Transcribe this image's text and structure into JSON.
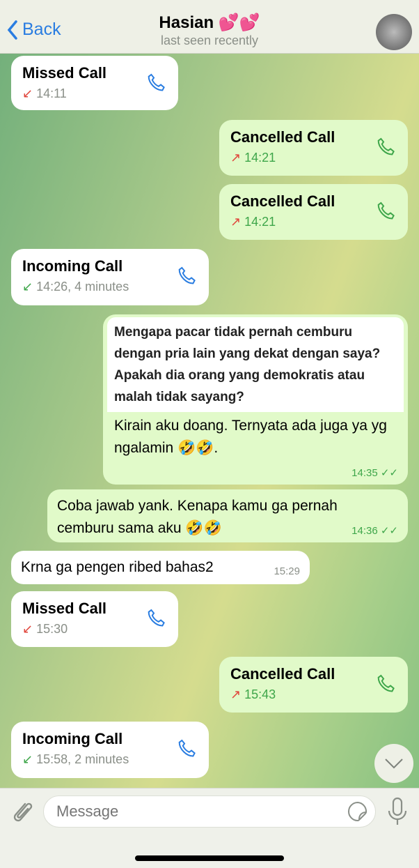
{
  "header": {
    "back_label": "Back",
    "title": "Hasian 💕💕",
    "subtitle": "last seen recently"
  },
  "messages": [
    {
      "type": "call",
      "dir": "in",
      "title": "Missed Call",
      "meta": "14:11",
      "arrow": "↙",
      "arrow_color": "#e0443a"
    },
    {
      "type": "call",
      "dir": "out",
      "title": "Cancelled Call",
      "meta": "14:21",
      "arrow": "↗"
    },
    {
      "type": "call",
      "dir": "out",
      "title": "Cancelled Call",
      "meta": "14:21",
      "arrow": "↗"
    },
    {
      "type": "call",
      "dir": "in",
      "title": "Incoming Call",
      "meta": "14:26, 4 minutes",
      "arrow": "↙",
      "arrow_color": "#3ea64a"
    },
    {
      "type": "text",
      "dir": "out",
      "quote": "Mengapa pacar tidak pernah cemburu dengan pria lain yang dekat dengan saya? Apakah dia orang yang demokratis atau malah tidak sayang?",
      "text": "Kirain aku doang. Ternyata ada juga ya yg ngalamin 🤣🤣.",
      "time": "14:35 ✓✓"
    },
    {
      "type": "text",
      "dir": "out",
      "text": "Coba jawab yank. Kenapa kamu ga pernah cemburu sama aku 🤣🤣",
      "time": "14:36 ✓✓"
    },
    {
      "type": "text",
      "dir": "in",
      "text": "Krna ga pengen ribed bahas2",
      "time": "15:29"
    },
    {
      "type": "call",
      "dir": "in",
      "title": "Missed Call",
      "meta": "15:30",
      "arrow": "↙",
      "arrow_color": "#e0443a"
    },
    {
      "type": "call",
      "dir": "out",
      "title": "Cancelled Call",
      "meta": "15:43",
      "arrow": "↗"
    },
    {
      "type": "call",
      "dir": "in",
      "title": "Incoming Call",
      "meta": "15:58, 2 minutes",
      "arrow": "↙",
      "arrow_color": "#3ea64a"
    }
  ],
  "input": {
    "placeholder": "Message"
  },
  "colors": {
    "accent": "#2a7de1",
    "outgoing_bubble": "#e1fac9",
    "incoming_bubble": "#ffffff",
    "missed": "#e0443a",
    "ok": "#3ea64a"
  }
}
